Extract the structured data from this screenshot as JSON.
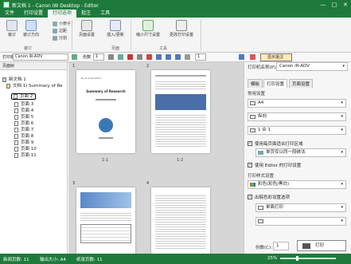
{
  "window": {
    "title": "新文档 1 - Canon iW Desktop - Editor",
    "controls": [
      "—",
      "□",
      "✕"
    ]
  },
  "menu": {
    "tabs": [
      "文件",
      "打印设置",
      "打印选项",
      "批注",
      "工具"
    ],
    "active": 2
  },
  "ribbon": {
    "buttons": {
      "booklet": "装订",
      "binding": "装订方向",
      "booklet2": "小册子",
      "margin": "边距",
      "split": "分割",
      "page_setup": "页面设置",
      "insert": "插入/更新",
      "shrink": "缩小尺寸设置",
      "change": "更改打印设置"
    },
    "groups": {
      "finishing": "装订",
      "page": "页面",
      "tools": "工具"
    }
  },
  "toolbar": {
    "printer_label": "打印机",
    "printer_value": "Canon iR-ADV",
    "copies_label": "份数",
    "copies_value": "1",
    "page_value": "1",
    "show_annotations": "显示批注"
  },
  "left_panel": {
    "header": "页面树",
    "tree": [
      "新文档 1",
      "文档 1) Summary of Re",
      "页面 2",
      "页面 3",
      "页面 4",
      "页面 5",
      "页面 6",
      "页面 7",
      "页面 8",
      "页面 9",
      "页面 10",
      "页面 11"
    ]
  },
  "pages": {
    "labels": [
      "1",
      "2",
      "3",
      "4"
    ],
    "captions": [
      "1-1",
      "1-2"
    ],
    "page1": {
      "title": "Summary of Research",
      "subtitle": "No.0 Corporation"
    }
  },
  "right_panel": {
    "printer_label": "打印机名称(P):",
    "printer_value": "Canon iR-ADV",
    "tabs": [
      "模板",
      "打印设置",
      "页面设置"
    ],
    "active_tab": 1,
    "section_general": "常用设置",
    "paper": "A4",
    "orientation": "纵向",
    "nup": "1 合 1",
    "check_align": "使用每页面适合打印区域",
    "binding_dd": "单页仅以同一段统法",
    "check_editor": "使用 Editor 的打印设置",
    "section_color": "打印样式设置",
    "color": "彩色(彩色/黑白)",
    "check_colorc": "出稿色彩设置选项",
    "single": "单面打印",
    "copies_label": "份数(C):",
    "copies_value": "1",
    "print_button": "打印"
  },
  "status": {
    "total_pages": "新闻页数: 11",
    "sheets": "输出大小: A4",
    "count": "纸张页数: 11",
    "zoom": "25%"
  },
  "colors": {
    "brand": "#1e7a3c",
    "ribbon_bg": "#f4f4f4"
  }
}
